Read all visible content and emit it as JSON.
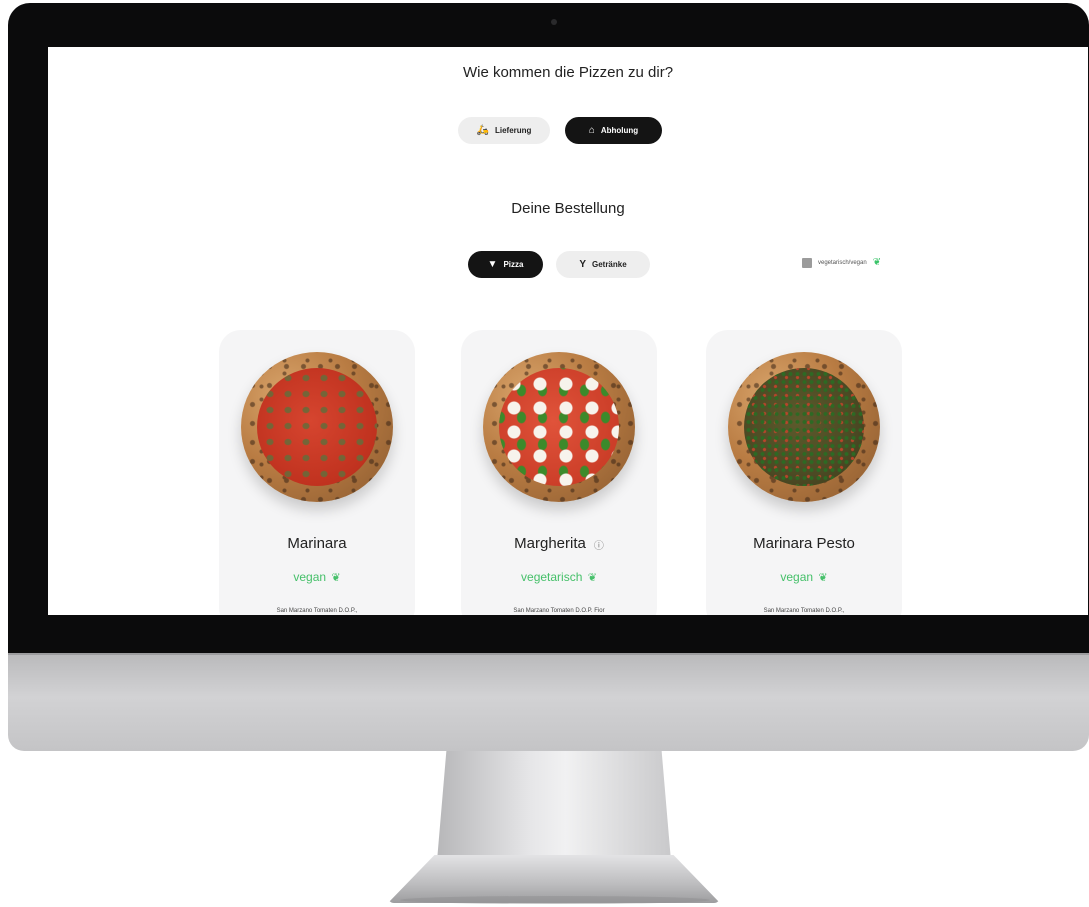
{
  "delivery": {
    "question": "Wie kommen die Pizzen zu dir?",
    "options": [
      {
        "label": "Lieferung",
        "icon": "scooter-icon",
        "selected": false
      },
      {
        "label": "Abholung",
        "icon": "basket-icon",
        "selected": true
      }
    ]
  },
  "order": {
    "title": "Deine Bestellung",
    "categories": [
      {
        "label": "Pizza",
        "icon": "pizza-icon",
        "selected": true
      },
      {
        "label": "Getränke",
        "icon": "cocktail-glass-icon",
        "selected": false
      }
    ],
    "filter": {
      "label": "vegetarisch/vegan",
      "checked": false,
      "icon": "leaf-icon"
    }
  },
  "products": [
    {
      "name": "Marinara",
      "tag": "vegan",
      "description": "San Marzano Tomaten D.O.P.,",
      "info": false
    },
    {
      "name": "Margherita",
      "tag": "vegetarisch",
      "description": "San Marzano Tomaten D.O.P. Fior",
      "info": true
    },
    {
      "name": "Marinara Pesto",
      "tag": "vegan",
      "description": "San Marzano Tomaten D.O.P.,",
      "info": false
    }
  ],
  "colors": {
    "accent_green": "#46c06a",
    "selected_pill": "#141414",
    "unselected_pill": "#eeeeee"
  }
}
